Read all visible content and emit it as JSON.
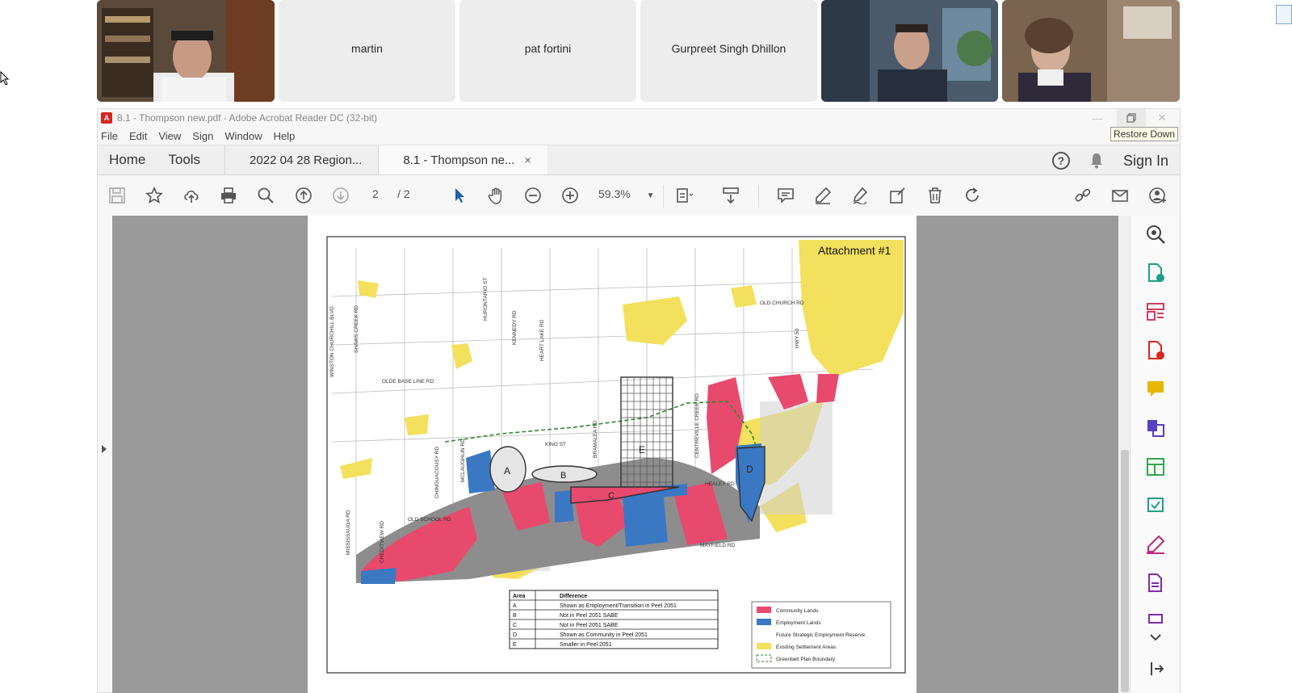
{
  "participants": {
    "martin": "martin",
    "pat": "pat fortini",
    "gurpreet": "Gurpreet Singh Dhillon"
  },
  "window": {
    "title": "8.1 - Thompson new.pdf - Adobe Acrobat Reader DC (32-bit)",
    "restore_tooltip": "Restore Down"
  },
  "menu": [
    "File",
    "Edit",
    "View",
    "Sign",
    "Window",
    "Help"
  ],
  "tabs": {
    "home": "Home",
    "tools": "Tools",
    "doc1": "2022 04 28 Region...",
    "doc2": "8.1 - Thompson ne...",
    "close": "×",
    "sign_in": "Sign In"
  },
  "toolbar": {
    "page_current": "2",
    "page_total": "/ 2",
    "zoom": "59.3%"
  },
  "map": {
    "attachment": "Attachment #1",
    "roads": {
      "olde_base": "OLDE BASE LINE RD",
      "old_church": "OLD CHURCH RD",
      "king": "KING ST",
      "old_school": "OLD SCHOOL RD",
      "healey": "HEALEY RD",
      "mayfield": "MAYFIELD RD",
      "winston": "WINSTON CHURCHILL BLVD",
      "shaws": "SHAWS CREEK RD",
      "hurontario": "HURONTARIO ST",
      "kennedy": "KENNEDY RD",
      "heart_lake": "HEART LAKE RD",
      "hwy50": "HWY 50",
      "bramalea": "BRAMALEA RD",
      "centreville": "CENTREVILLE CREEK RD",
      "mclaughlin": "MCLAUGHLIN RD",
      "chinguacousy": "CHINGUACOUSY RD",
      "mississauga": "MISSISSAUGA RD",
      "creditview": "CREDITVIEW RD"
    },
    "areas": [
      "A",
      "B",
      "C",
      "D",
      "E"
    ],
    "table": {
      "header": [
        "Area",
        "Difference"
      ],
      "rows": [
        [
          "A",
          "Shown as Employment/Transition in Peel 2051"
        ],
        [
          "B",
          "Not in Peel 2051 SABE"
        ],
        [
          "C",
          "Not in Peel 2051 SABE"
        ],
        [
          "D",
          "Shown as Community in Peel 2051"
        ],
        [
          "E",
          "Smaller in Peel 2051"
        ]
      ]
    },
    "legend": [
      {
        "label": "Community Lands",
        "color": "#e84a6e"
      },
      {
        "label": "Employment Lands",
        "color": "#3b78c4"
      },
      {
        "label": "Future Strategic Employment Reserve",
        "color": "#ffffff"
      },
      {
        "label": "Existing Settlement Areas",
        "color": "#f5e15a"
      },
      {
        "label": "Greenbelt Plan Boundary",
        "color": "#3a8a3a"
      }
    ]
  }
}
